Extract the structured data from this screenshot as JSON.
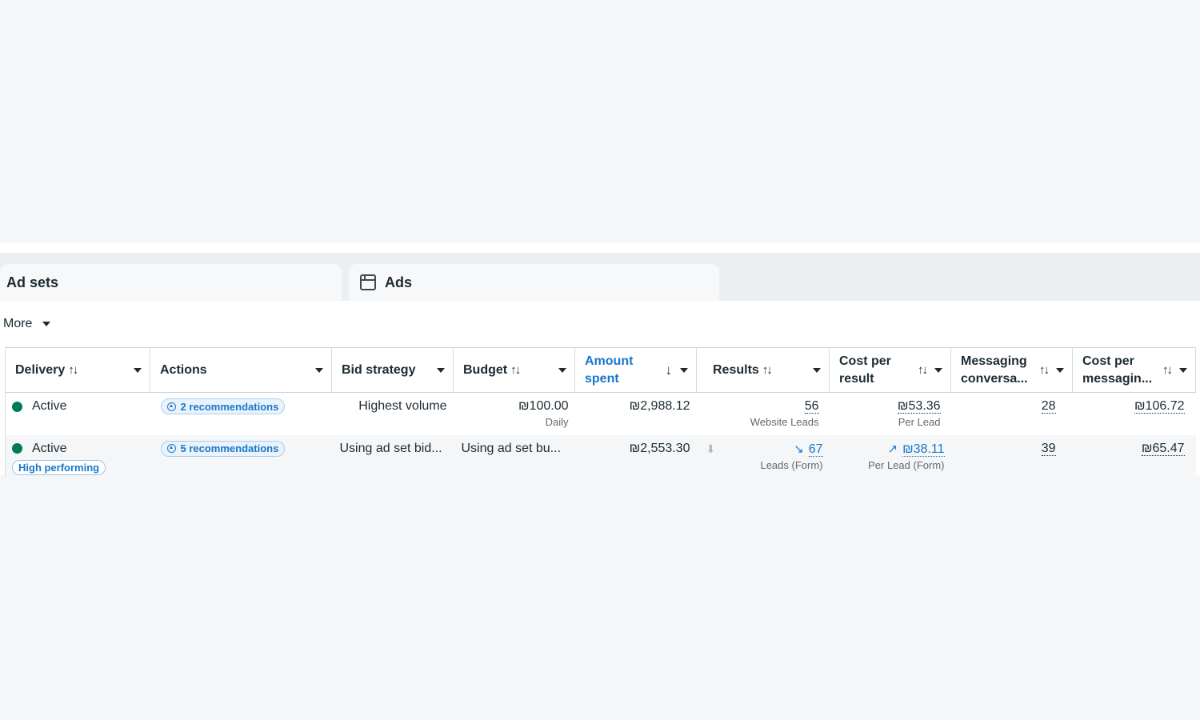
{
  "tabs": [
    {
      "label": "Ad sets"
    },
    {
      "label": "Ads",
      "icon": "ad-icon"
    }
  ],
  "toolbar": {
    "more_label": "More"
  },
  "columns": [
    {
      "label": "Delivery",
      "sort_icon": "↑↓"
    },
    {
      "label": "Actions"
    },
    {
      "label": "Bid strategy"
    },
    {
      "label": "Budget",
      "sort_icon": "↑↓"
    },
    {
      "label": "Amount spent",
      "sort_icon": "↓"
    },
    {
      "label": "Results",
      "sort_icon": "↑↓"
    },
    {
      "label": "Cost per result",
      "sort_icon": "↑↓"
    },
    {
      "label": "Messaging conversa...",
      "sort_icon": "↑↓"
    },
    {
      "label": "Cost per messagin...",
      "sort_icon": "↑↓"
    }
  ],
  "rows": [
    {
      "delivery": "Active",
      "badge": "",
      "actions": "2 recommendations",
      "bid_strategy": "Highest volume",
      "budget": "₪100.00",
      "budget_sub": "Daily",
      "amount_spent": "₪2,988.12",
      "results": "56",
      "results_sub": "Website Leads",
      "cost_per_result": "₪53.36",
      "cost_per_result_sub": "Per Lead",
      "messaging": "28",
      "cost_per_messaging": "₪106.72"
    },
    {
      "delivery": "Active",
      "badge": "High performing",
      "actions": "5 recommendations",
      "bid_strategy": "Using ad set bid...",
      "budget": "Using ad set bu...",
      "budget_sub": "",
      "amount_spent": "₪2,553.30",
      "results": "67",
      "results_sub": "Leads (Form)",
      "results_trend": "down",
      "cost_per_result": "₪38.11",
      "cost_per_result_sub": "Per Lead (Form)",
      "cost_trend": "up",
      "messaging": "39",
      "cost_per_messaging": "₪65.47"
    }
  ],
  "colors": {
    "accent": "#1877c9",
    "active_dot": "#007a5a"
  }
}
